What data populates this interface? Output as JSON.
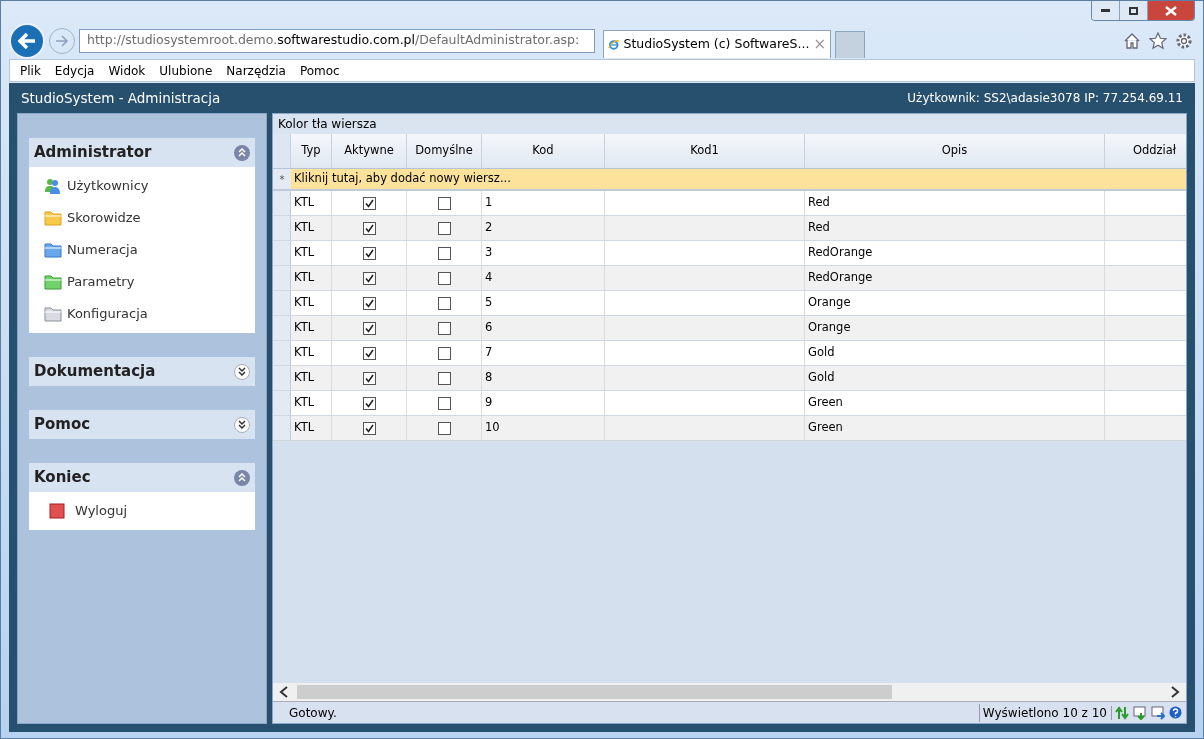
{
  "browser": {
    "address": {
      "prefix": "http://studiosystemroot.demo.",
      "domain": "softwarestudio.com.pl",
      "suffix": "/DefaultAdministrator.asp:"
    },
    "tabs": [
      {
        "label": "StudioSystem (c) SoftwareS...",
        "close": "×",
        "selected": true
      }
    ],
    "menu": [
      "Plik",
      "Edycja",
      "Widok",
      "Ulubione",
      "Narzędzia",
      "Pomoc"
    ]
  },
  "app": {
    "title": "StudioSystem - Administracja",
    "user_info": "Użytkownik: SS2\\adasie3078 IP: 77.254.69.11"
  },
  "sidebar": {
    "sections": [
      {
        "title": "Administrator",
        "expanded": true,
        "items": [
          {
            "label": "Użytkownicy"
          },
          {
            "label": "Skorowidze"
          },
          {
            "label": "Numeracja"
          },
          {
            "label": "Parametry"
          },
          {
            "label": "Konfiguracja"
          }
        ]
      },
      {
        "title": "Dokumentacja",
        "expanded": false
      },
      {
        "title": "Pomoc",
        "expanded": false
      },
      {
        "title": "Koniec",
        "expanded": true,
        "items": [
          {
            "label": "Wyloguj"
          }
        ]
      }
    ]
  },
  "grid": {
    "caption": "Kolor tła wiersza",
    "columns": [
      "Typ",
      "Aktywne",
      "Domyślne",
      "Kod",
      "Kod1",
      "Opis",
      "Oddział"
    ],
    "new_row_marker": "*",
    "new_row_text": "Kliknij tutaj, aby dodać nowy wiersz...",
    "rows": [
      {
        "typ": "KTL",
        "aktywne": true,
        "domyslne": false,
        "kod": "1",
        "opis": "Red"
      },
      {
        "typ": "KTL",
        "aktywne": true,
        "domyslne": false,
        "kod": "2",
        "opis": "Red"
      },
      {
        "typ": "KTL",
        "aktywne": true,
        "domyslne": false,
        "kod": "3",
        "opis": "RedOrange"
      },
      {
        "typ": "KTL",
        "aktywne": true,
        "domyslne": false,
        "kod": "4",
        "opis": "RedOrange"
      },
      {
        "typ": "KTL",
        "aktywne": true,
        "domyslne": false,
        "kod": "5",
        "opis": "Orange"
      },
      {
        "typ": "KTL",
        "aktywne": true,
        "domyslne": false,
        "kod": "6",
        "opis": "Orange"
      },
      {
        "typ": "KTL",
        "aktywne": true,
        "domyslne": false,
        "kod": "7",
        "opis": "Gold"
      },
      {
        "typ": "KTL",
        "aktywne": true,
        "domyslne": false,
        "kod": "8",
        "opis": "Gold"
      },
      {
        "typ": "KTL",
        "aktywne": true,
        "domyslne": false,
        "kod": "9",
        "opis": "Green"
      },
      {
        "typ": "KTL",
        "aktywne": true,
        "domyslne": false,
        "kod": "10",
        "opis": "Green"
      }
    ],
    "status": "Gotowy.",
    "count": "Wyświetlono 10 z 10"
  }
}
